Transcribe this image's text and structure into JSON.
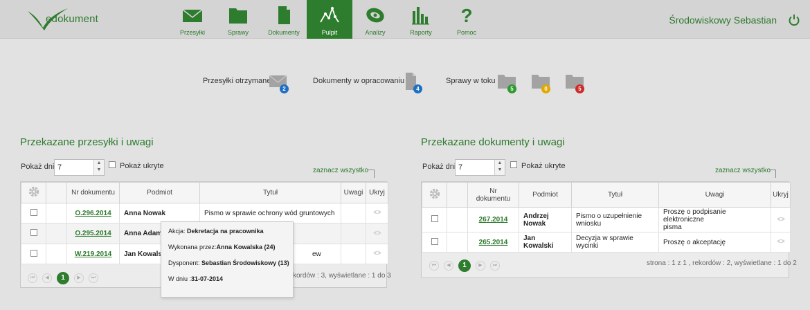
{
  "app": {
    "logo_text": "edokument",
    "user_name": "Środowiskowy Sebastian"
  },
  "nav": [
    {
      "label": "Przesyłki",
      "icon": "envelope-icon"
    },
    {
      "label": "Sprawy",
      "icon": "folder-icon"
    },
    {
      "label": "Dokumenty",
      "icon": "document-icon"
    },
    {
      "label": "Pulpit",
      "icon": "pulse-icon",
      "active": true
    },
    {
      "label": "Analizy",
      "icon": "analysis-icon"
    },
    {
      "label": "Raporty",
      "icon": "bar-chart-icon"
    },
    {
      "label": "Pomoc",
      "icon": "help-icon"
    }
  ],
  "summary": {
    "przesylki_label": "Przesyłki otrzymane",
    "przesylki_count": "2",
    "dokumenty_label": "Dokumenty w opracowaniu",
    "dokumenty_count": "4",
    "sprawy_label": "Sprawy w toku",
    "sprawy_green": "5",
    "sprawy_yellow": "0",
    "sprawy_red": "5",
    "colors": {
      "blue": "#1e6fc2",
      "green": "#2e9a2e",
      "yellow": "#e0a800",
      "red": "#cf2a2a"
    }
  },
  "left": {
    "title": "Przekazane przesyłki i uwagi",
    "pokaz_dni_label": "Pokaż dni",
    "pokaz_dni_value": "7",
    "pokaz_ukryte_label": "Pokaż ukryte",
    "zaznacz_label": "zaznacz wszystko",
    "headers": {
      "nr": "Nr dokumentu",
      "podmiot": "Podmiot",
      "tytul": "Tytuł",
      "uwagi": "Uwagi",
      "ukryj": "Ukryj"
    },
    "rows": [
      {
        "nr": "O.296.2014",
        "podmiot": "Anna Nowak",
        "tytul": "Pismo w sprawie ochrony wód gruntowych",
        "uwagi": ""
      },
      {
        "nr": "O.295.2014",
        "podmiot": "Anna Adamc",
        "tytul": "",
        "uwagi": ""
      },
      {
        "nr": "W.219.2014",
        "podmiot": "Jan Kowalski",
        "tytul": "ew",
        "uwagi": ""
      }
    ],
    "page": "1",
    "pager_info": "kordów : 3, wyświetlane : 1 do 3"
  },
  "right": {
    "title": "Przekazane dokumenty i uwagi",
    "pokaz_dni_label": "Pokaż dni",
    "pokaz_dni_value": "7",
    "pokaz_ukryte_label": "Pokaż ukryte",
    "zaznacz_label": "zaznacz wszystko",
    "headers": {
      "nr_line1": "Nr",
      "nr_line2": "dokumentu",
      "podmiot": "Podmiot",
      "tytul": "Tytuł",
      "uwagi": "Uwagi",
      "ukryj": "Ukryj"
    },
    "rows": [
      {
        "nr": "267.2014",
        "podmiot_line1": "Andrzej",
        "podmiot_line2": "Nowak",
        "tytul_line1": "Pismo o uzupełnienie",
        "tytul_line2": "wniosku",
        "uwagi_line1": "Proszę o podpisanie elektroniczne",
        "uwagi_line2": "pisma"
      },
      {
        "nr": "265.2014",
        "podmiot_line1": "Jan Kowalski",
        "podmiot_line2": "",
        "tytul_line1": "Decyzja w sprawie wycinki",
        "tytul_line2": "",
        "uwagi_line1": "Proszę o akceptację",
        "uwagi_line2": ""
      }
    ],
    "page": "1",
    "pager_info": "strona : 1 z 1 , rekordów : 2, wyświetlane : 1 do 2"
  },
  "tooltip": {
    "akcja_label": "Akcja:",
    "akcja_value": "Dekretacja na pracownika",
    "wykonana_label": "Wykonana przez:",
    "wykonana_value": "Anna Kowalska (24)",
    "dysponent_label": "Dysponent:",
    "dysponent_value": "Sebastian Środowiskowy (13)",
    "data_label": "W dniu :",
    "data_value": "31-07-2014"
  }
}
